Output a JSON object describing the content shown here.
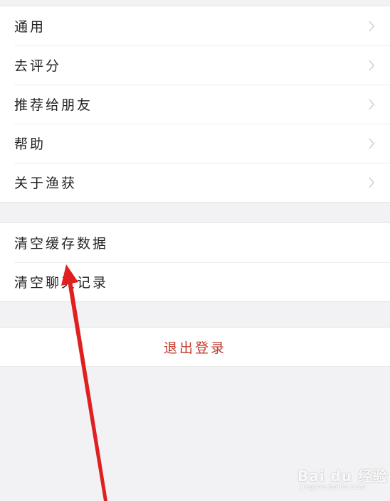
{
  "settings": {
    "items": [
      {
        "label": "通用"
      },
      {
        "label": "去评分"
      },
      {
        "label": "推荐给朋友"
      },
      {
        "label": "帮助"
      },
      {
        "label": "关于渔获"
      }
    ]
  },
  "data_section": {
    "items": [
      {
        "label": "清空缓存数据"
      },
      {
        "label": "清空聊天记录"
      }
    ]
  },
  "logout": {
    "label": "退出登录",
    "color": "#c0392b"
  },
  "watermark": {
    "main": "Bai du 经验",
    "sub": "jingyan.baidu.com"
  },
  "annotation": {
    "arrow_color": "#e02020"
  }
}
